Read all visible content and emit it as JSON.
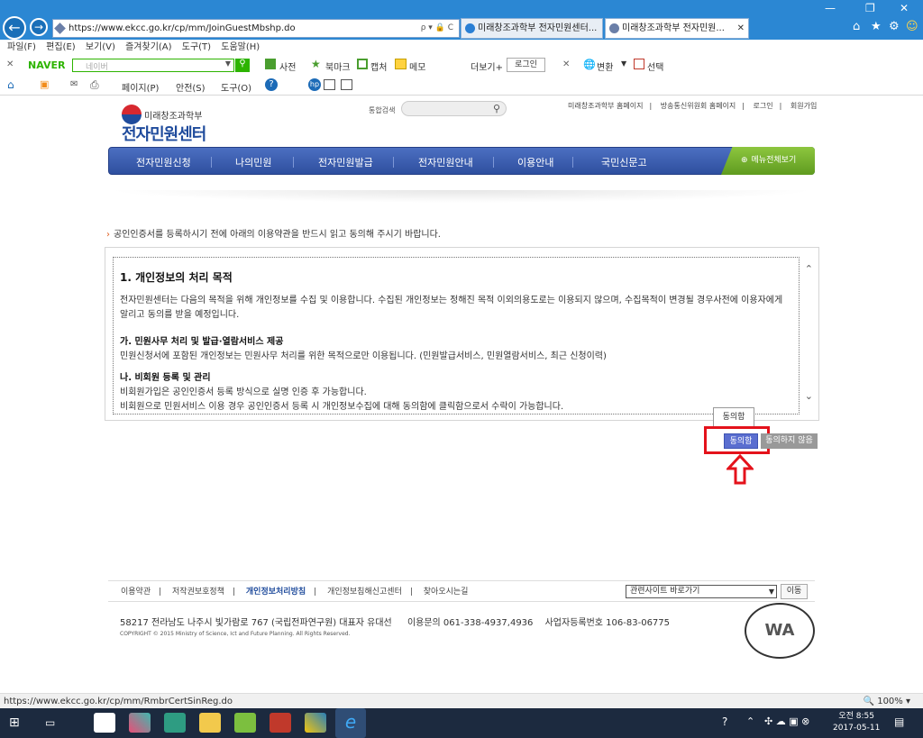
{
  "browser": {
    "url": "https://www.ekcc.go.kr/cp/mm/JoinGuestMbshp.do",
    "addr_controls": "ρ ▾ 🔒 C",
    "tabs": [
      {
        "label": "미래창조과학부 전자민원센터..."
      },
      {
        "label": "미래창조과학부 전자민원..."
      }
    ],
    "menu": [
      "파일(F)",
      "편집(E)",
      "보기(V)",
      "즐겨찾기(A)",
      "도구(T)",
      "도움말(H)"
    ],
    "naver": {
      "logo": "NAVER",
      "placeholder": "네이버",
      "items": [
        "사전",
        "북마크",
        "캡처",
        "메모"
      ],
      "more": "더보기+",
      "login": "로그인",
      "tools": [
        "변환",
        "선택"
      ]
    },
    "command_bar": [
      "페이지(P)",
      "안전(S)",
      "도구(O)"
    ],
    "status_url": "https://www.ekcc.go.kr/cp/mm/RmbrCertSinReg.do",
    "zoom": "100%"
  },
  "site": {
    "logo_sub": "미래창조과학부",
    "logo_main": "전자민원센터",
    "search_label": "통합검색",
    "top_links": [
      "미래창조과학부 홈페이지",
      "방송통신위원회 홈페이지",
      "로그인",
      "회원가입"
    ],
    "gnb": [
      "전자민원신청",
      "나의민원",
      "전자민원발급",
      "전자민원안내",
      "이용안내",
      "국민신문고"
    ],
    "all_menu": "메뉴전체보기"
  },
  "content": {
    "notice": "공인인증서를 등록하시기 전에 아래의 이용약관을 반드시 읽고 동의해 주시기 바랍니다.",
    "terms_title": "1. 개인정보의 처리 목적",
    "terms_intro": "전자민원센터는 다음의 목적을 위해 개인정보를 수집 및 이용합니다. 수집된 개인정보는 정해진 목적 이외의용도로는 이용되지 않으며, 수집목적이 변경될 경우사전에 이용자에게 알리고 동의를 받을 예정입니다.",
    "section_a_title": "가. 민원사무 처리 및 발급·열람서비스 제공",
    "section_a_body": "민원신청서에 포함된 개인정보는 민원사무 처리를 위한 목적으로만 이용됩니다. (민원발급서비스, 민원열람서비스, 최근 신청이력)",
    "section_b_title": "나. 비회원 등록 및 관리",
    "section_b_body1": "비회원가입은 공인인증서 등록 방식으로 실명 인증 후 가능합니다.",
    "section_b_body2": "비회원으로 민원서비스 이용 경우 공인인증서 등록 시 개인정보수집에 대해 동의함에 클릭함으로서 수락이 가능합니다.",
    "tooltip": "동의함",
    "agree": "동의함",
    "disagree": "동의하지 않음"
  },
  "footer": {
    "links": [
      "이용약관",
      "저작권보호정책",
      "개인정보처리방침",
      "개인정보침해신고센터",
      "찾아오시는길"
    ],
    "related_select": "관련사이트 바로가기",
    "go": "이동",
    "address": "58217 전라남도 나주시 빛가람로 767 (국립전파연구원) 대표자 유대선",
    "contact": "이용문의 061-338-4937,4936",
    "biz_no": "사업자등록번호 106-83-06775",
    "copyright": "COPYRIGHT © 2015 Ministry of Science, Ict and Future Planning. All Rights Reserved.",
    "wa_mark": "WA"
  },
  "taskbar": {
    "time": "오전 8:55",
    "date": "2017-05-11"
  }
}
